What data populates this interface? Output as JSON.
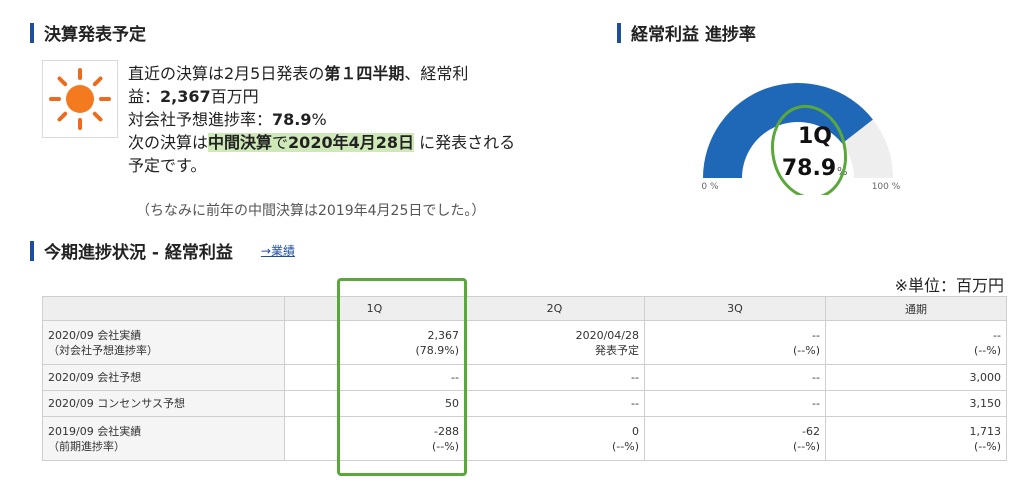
{
  "sections": {
    "announcement_title": "決算発表予定",
    "progress_title": "経常利益 進捗率",
    "status_title": "今期進捗状況 - 経常利益",
    "results_link": "→業績"
  },
  "announcement": {
    "line1": "直近の決算は2月5日発表の",
    "line1_bold": "第１四半期",
    "line1_end": "、経常利",
    "line2_start": "益：",
    "line2_bold": "2,367",
    "line2_end": "百万円",
    "line3_start": "対会社予想進捗率：",
    "line3_bold": "78.9",
    "line3_end": "%",
    "line4_start": "次の決算は",
    "line4_bold1": "中間決算",
    "line4_mid": "で",
    "line4_bold2": "2020年4月28日",
    "line4_end": "に発表される",
    "line5": "予定です。",
    "prev_note": "（ちなみに前年の中間決算は2019年4月25日でした。）"
  },
  "gauge": {
    "quarter": "1Q",
    "value_text": "78.9",
    "unit": "%",
    "progress_pct": 78.9,
    "min_label": "0 %",
    "max_label": "100 %",
    "fill_color": "#1f68b8",
    "bg_color": "#eeeeee"
  },
  "unit_note": "※単位：百万円",
  "table": {
    "headers": [
      "1Q",
      "2Q",
      "3Q",
      "通期"
    ],
    "rows": [
      {
        "label": [
          "2020/09 会社実績",
          "（対会社予想進捗率）"
        ],
        "cells": [
          [
            "2,367",
            "(78.9%)"
          ],
          [
            "2020/04/28",
            "発表予定"
          ],
          [
            "--",
            "(--%)"
          ],
          [
            "--",
            "(--%)"
          ]
        ]
      },
      {
        "label": [
          "2020/09 会社予想"
        ],
        "cells": [
          [
            "--"
          ],
          [
            "--"
          ],
          [
            "--"
          ],
          [
            "3,000"
          ]
        ]
      },
      {
        "label": [
          "2020/09 コンセンサス予想"
        ],
        "cells": [
          [
            "50"
          ],
          [
            "--"
          ],
          [
            "--"
          ],
          [
            "3,150"
          ]
        ]
      },
      {
        "label": [
          "2019/09 会社実績",
          "（前期進捗率）"
        ],
        "cells": [
          [
            "-288",
            "(--%)"
          ],
          [
            "0",
            "(--%)"
          ],
          [
            "-62",
            "(--%)"
          ],
          [
            "1,713",
            "(--%)"
          ]
        ]
      }
    ]
  }
}
